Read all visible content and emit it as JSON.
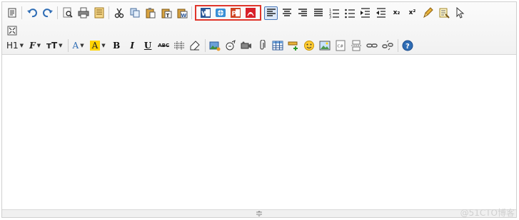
{
  "toolbar": {
    "row1_icons": [
      "source-code-icon",
      "undo-icon",
      "redo-icon",
      "print-preview-icon",
      "print-icon",
      "template-icon",
      "cut-icon",
      "copy-icon",
      "paste-icon",
      "paste-text-icon",
      "paste-word-icon"
    ],
    "import_icons": [
      "word-import-icon",
      "web-import-icon",
      "powerpoint-import-icon",
      "pdf-import-icon"
    ],
    "format_icons": [
      "align-left-icon",
      "align-center-icon",
      "align-right-icon",
      "justify-icon",
      "ordered-list-icon",
      "unordered-list-icon",
      "indent-icon",
      "outdent-icon",
      "subscript-label",
      "superscript-label",
      "clear-format-icon",
      "select-all-icon",
      "pointer-icon"
    ],
    "subscript_label": "x₂",
    "superscript_label": "x²",
    "fullscreen_icon": "fullscreen-icon",
    "heading_label": "H1",
    "font_family_label": "F",
    "font_size_label": "тT",
    "font_color_label": "A",
    "highlight_label": "A",
    "bold_label": "B",
    "italic_label": "I",
    "underline_label": "U",
    "strikethrough_label": "ABC",
    "help_icon": "help-icon"
  },
  "colors": {
    "accent_border": "#e0352b",
    "active_align": "#4a78b8",
    "highlight_yellow": "#ffd400"
  },
  "watermark": "@51CTO博客"
}
